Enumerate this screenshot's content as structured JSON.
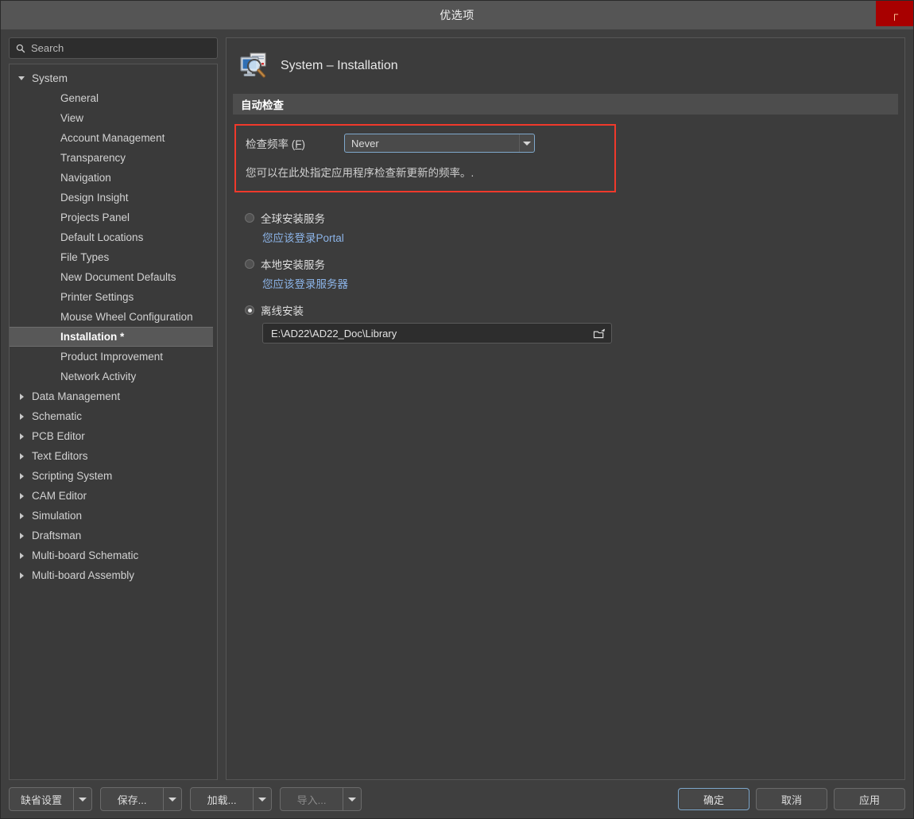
{
  "window": {
    "title": "优选项",
    "close_label": "┌"
  },
  "search": {
    "placeholder": "Search",
    "value": "",
    "icon": "search-icon"
  },
  "sidebar": {
    "items": [
      {
        "label": "System",
        "level": 1,
        "expanded": true,
        "selected": false
      },
      {
        "label": "General",
        "level": 2,
        "selected": false
      },
      {
        "label": "View",
        "level": 2,
        "selected": false
      },
      {
        "label": "Account Management",
        "level": 2,
        "selected": false
      },
      {
        "label": "Transparency",
        "level": 2,
        "selected": false
      },
      {
        "label": "Navigation",
        "level": 2,
        "selected": false
      },
      {
        "label": "Design Insight",
        "level": 2,
        "selected": false
      },
      {
        "label": "Projects Panel",
        "level": 2,
        "selected": false
      },
      {
        "label": "Default Locations",
        "level": 2,
        "selected": false
      },
      {
        "label": "File Types",
        "level": 2,
        "selected": false
      },
      {
        "label": "New Document Defaults",
        "level": 2,
        "selected": false
      },
      {
        "label": "Printer Settings",
        "level": 2,
        "selected": false
      },
      {
        "label": "Mouse Wheel Configuration",
        "level": 2,
        "selected": false
      },
      {
        "label": "Installation *",
        "level": 2,
        "selected": true
      },
      {
        "label": "Product Improvement",
        "level": 2,
        "selected": false
      },
      {
        "label": "Network Activity",
        "level": 2,
        "selected": false
      },
      {
        "label": "Data Management",
        "level": 1,
        "expanded": false,
        "selected": false
      },
      {
        "label": "Schematic",
        "level": 1,
        "expanded": false,
        "selected": false
      },
      {
        "label": "PCB Editor",
        "level": 1,
        "expanded": false,
        "selected": false
      },
      {
        "label": "Text Editors",
        "level": 1,
        "expanded": false,
        "selected": false
      },
      {
        "label": "Scripting System",
        "level": 1,
        "expanded": false,
        "selected": false
      },
      {
        "label": "CAM Editor",
        "level": 1,
        "expanded": false,
        "selected": false
      },
      {
        "label": "Simulation",
        "level": 1,
        "expanded": false,
        "selected": false
      },
      {
        "label": "Draftsman",
        "level": 1,
        "expanded": false,
        "selected": false
      },
      {
        "label": "Multi-board Schematic",
        "level": 1,
        "expanded": false,
        "selected": false
      },
      {
        "label": "Multi-board Assembly",
        "level": 1,
        "expanded": false,
        "selected": false
      }
    ]
  },
  "page": {
    "title": "System – Installation",
    "icon": "monitor-magnifier-icon",
    "section_header": "自动检查"
  },
  "frequency": {
    "label_prefix": "检查频率 (",
    "label_mnemonic": "F",
    "label_suffix": ")",
    "value": "Never",
    "hint": "您可以在此处指定应用程序检查新更新的频率。.",
    "highlight_color": "#f0392b"
  },
  "install_options": [
    {
      "label": "全球安装服务",
      "selected": false,
      "link": "您应该登录Portal"
    },
    {
      "label": "本地安装服务",
      "selected": false,
      "link": "您应该登录服务器"
    },
    {
      "label": "离线安装",
      "selected": true,
      "path_value": "E:\\AD22\\AD22_Doc\\Library",
      "path_placeholder": "",
      "browse_icon": "open-folder-icon"
    }
  ],
  "footer": {
    "left_buttons": [
      {
        "label": "缺省设置",
        "disabled": false
      },
      {
        "label": "保存...",
        "disabled": false
      },
      {
        "label": "加载...",
        "disabled": false
      },
      {
        "label": "导入...",
        "disabled": true
      }
    ],
    "ok_label": "确定",
    "cancel_label": "取消",
    "apply_label": "应用"
  },
  "colors": {
    "window_bg": "#3f3f3f",
    "titlebar": "#555555",
    "close_red": "#a80000",
    "panel_bg": "#3c3c3c",
    "section_header_bg": "#4d4d4d",
    "accent_blue": "#7fa8cc",
    "link_blue": "#8cb4e8",
    "highlight_red": "#f0392b",
    "selected_row": "#585858"
  }
}
